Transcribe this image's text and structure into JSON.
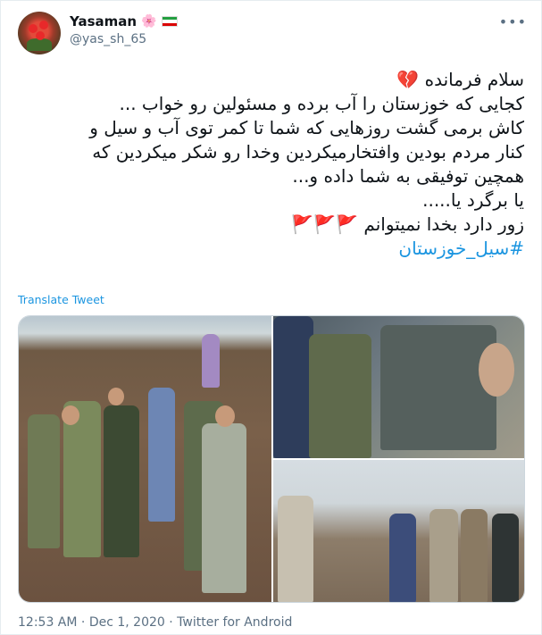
{
  "user": {
    "name": "Yasaman",
    "name_emoji": "🌸",
    "handle": "@yas_sh_65"
  },
  "menu_icon": "more-options-icon",
  "tweet": {
    "lines": [
      "سلام فرمانده 💔",
      "کجایی که خوزستان را آب برده و مسئولین رو خواب ...",
      "کاش برمی گشت روزهایی که شما تا کمر توی آب و سیل و",
      "کنار مردم بودین وافتخارمیکردین وخدا رو شکر میکردین که",
      "همچین توفیقی به شما داده و...",
      "یا برگرد یا.....",
      "زور دارد بخدا نمیتوانم 🚩🚩🚩"
    ],
    "hashtag": "#سیل_خوزستان"
  },
  "translate_label": "Translate Tweet",
  "footer": {
    "time": "12:53 AM",
    "separator1": " · ",
    "date": "Dec 1, 2020",
    "separator2": " · ",
    "source": "Twitter for Android"
  },
  "colors": {
    "link": "#1b95e0",
    "muted": "#5b7083",
    "border": "#e6ecf0"
  }
}
